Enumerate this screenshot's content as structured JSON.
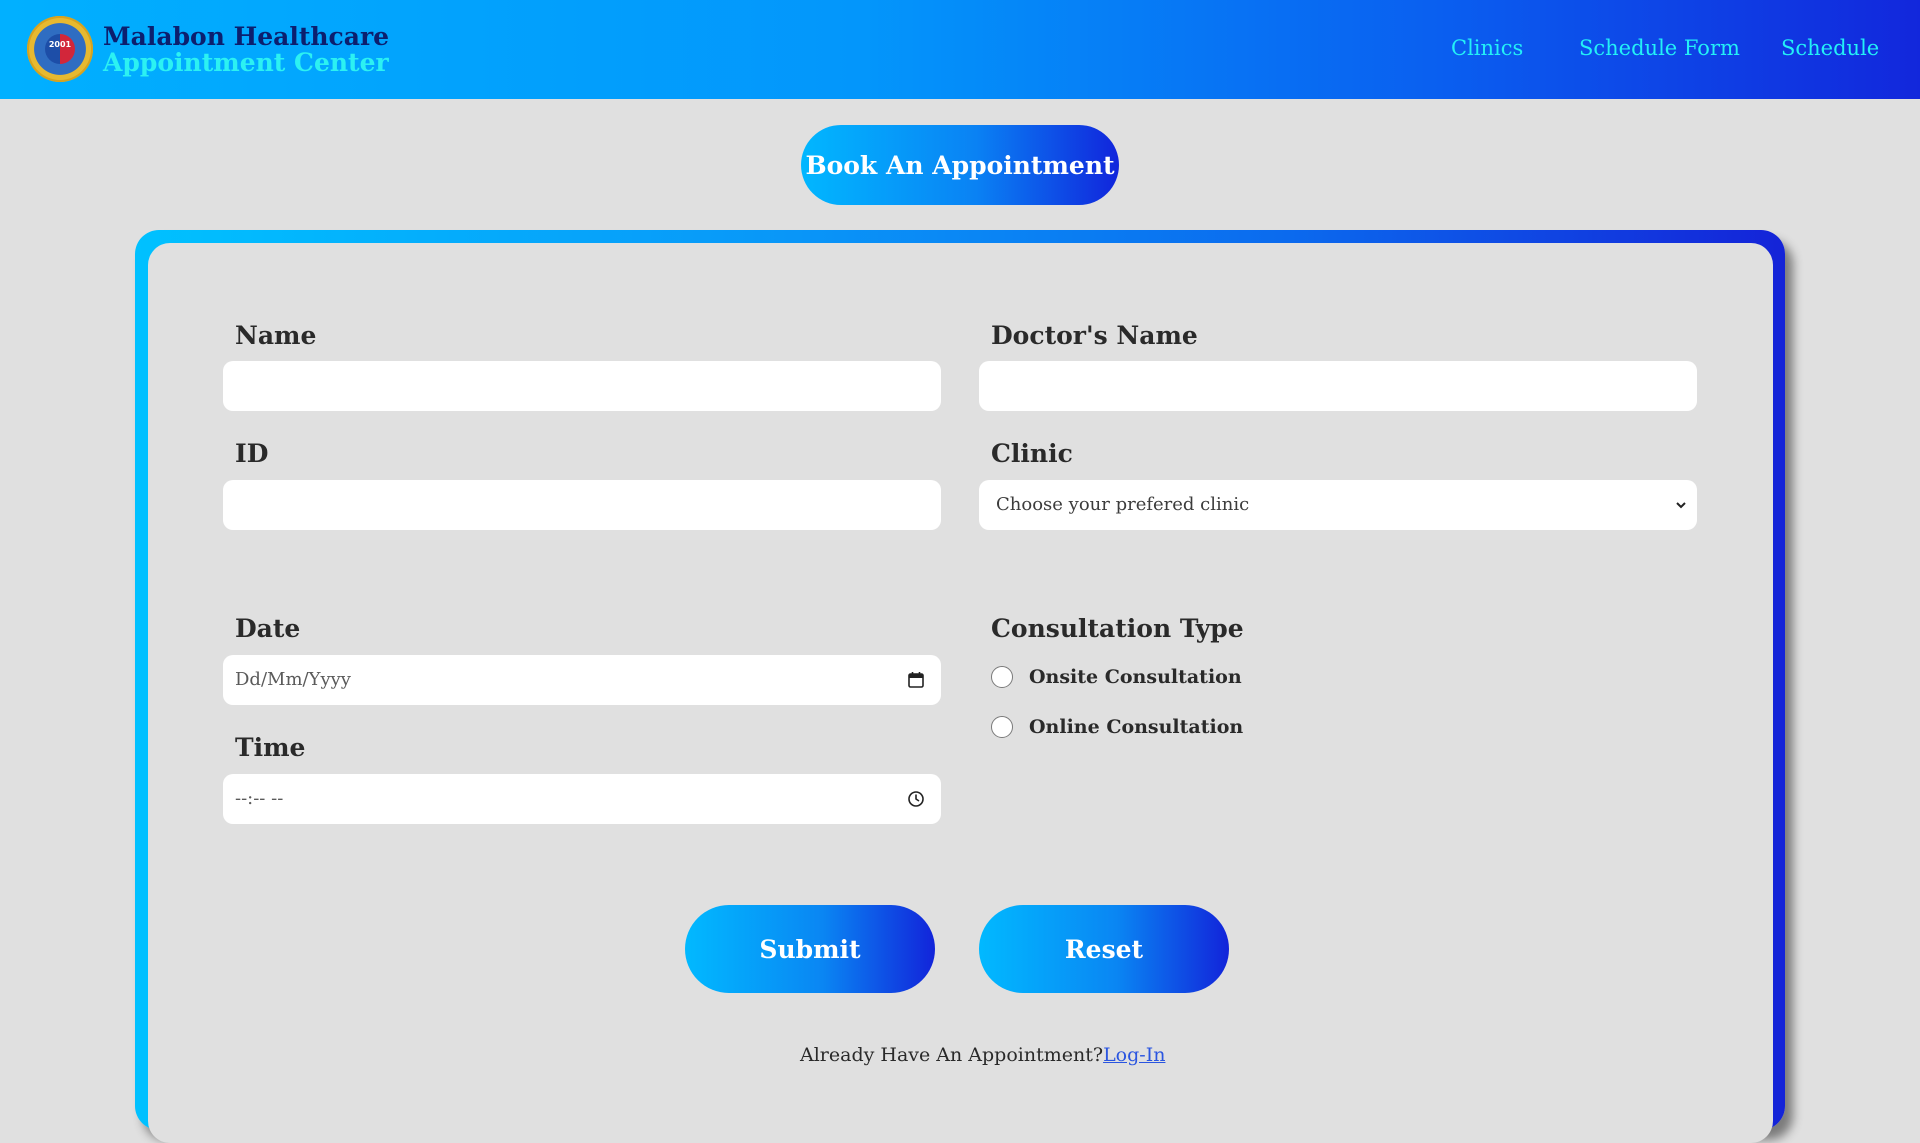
{
  "header": {
    "brand_line1": "Malabon Healthcare",
    "brand_line2": "Appointment Center",
    "logo_year": "2001",
    "nav": [
      "Clinics",
      "Schedule Form",
      "Schedule"
    ]
  },
  "page": {
    "title": "Book An Appointment"
  },
  "form": {
    "name_label": "Name",
    "name_value": "",
    "doctor_label": "Doctor's Name",
    "doctor_value": "",
    "id_label": "ID",
    "id_value": "",
    "clinic_label": "Clinic",
    "clinic_selected": "Choose your prefered clinic",
    "date_label": "Date",
    "date_placeholder": "Dd/Mm/Yyyy",
    "time_label": "Time",
    "time_placeholder": "--:-- --",
    "consultation_label": "Consultation Type",
    "consultation_options": [
      "Onsite Consultation",
      "Online Consultation"
    ],
    "submit_label": "Submit",
    "reset_label": "Reset",
    "already_text": "Already Have An Appointment?",
    "login_link": "Log-In"
  },
  "colors": {
    "header_start": "#01b0ff",
    "header_end": "#1227dc",
    "brand_dark": "#0c1f6e",
    "brand_cyan": "#2cf1f2",
    "nav_text": "#23f0f6",
    "background": "#e0e0e0"
  }
}
